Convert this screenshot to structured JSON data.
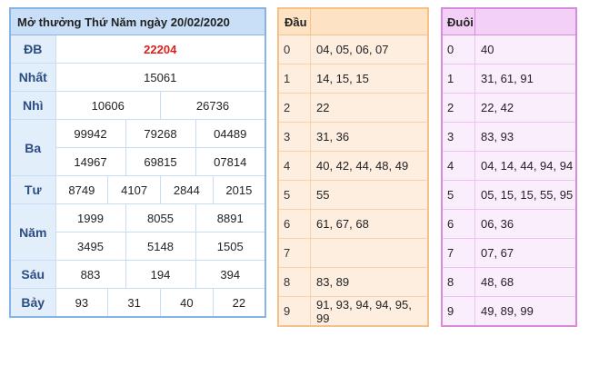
{
  "main": {
    "title": "Mở thưởng Thứ Năm ngày 20/02/2020",
    "rows": {
      "db": {
        "label": "ĐB",
        "values": [
          "22204"
        ]
      },
      "nhat": {
        "label": "Nhất",
        "values": [
          "15061"
        ]
      },
      "nhi": {
        "label": "Nhì",
        "values": [
          "10606",
          "26736"
        ]
      },
      "ba": {
        "label": "Ba",
        "values": [
          "99942",
          "79268",
          "04489",
          "14967",
          "69815",
          "07814"
        ]
      },
      "tu": {
        "label": "Tư",
        "values": [
          "8749",
          "4107",
          "2844",
          "2015"
        ]
      },
      "nam": {
        "label": "Năm",
        "values": [
          "1999",
          "8055",
          "8891",
          "3495",
          "5148",
          "1505"
        ]
      },
      "sau": {
        "label": "Sáu",
        "values": [
          "883",
          "194",
          "394"
        ]
      },
      "bay": {
        "label": "Bảy",
        "values": [
          "93",
          "31",
          "40",
          "22"
        ]
      }
    }
  },
  "dau": {
    "header": "Đầu",
    "rows": [
      {
        "k": "0",
        "v": "04, 05, 06, 07"
      },
      {
        "k": "1",
        "v": "14, 15, 15"
      },
      {
        "k": "2",
        "v": "22"
      },
      {
        "k": "3",
        "v": "31, 36"
      },
      {
        "k": "4",
        "v": "40, 42, 44, 48, 49"
      },
      {
        "k": "5",
        "v": "55"
      },
      {
        "k": "6",
        "v": "61, 67, 68"
      },
      {
        "k": "7",
        "v": ""
      },
      {
        "k": "8",
        "v": "83, 89"
      },
      {
        "k": "9",
        "v": "91, 93, 94, 94, 95, 99"
      }
    ]
  },
  "duoi": {
    "header": "Đuôi",
    "rows": [
      {
        "k": "0",
        "v": "40"
      },
      {
        "k": "1",
        "v": "31, 61, 91"
      },
      {
        "k": "2",
        "v": "22, 42"
      },
      {
        "k": "3",
        "v": "83, 93"
      },
      {
        "k": "4",
        "v": "04, 14, 44, 94, 94"
      },
      {
        "k": "5",
        "v": "05, 15, 15, 55, 95"
      },
      {
        "k": "6",
        "v": "06, 36"
      },
      {
        "k": "7",
        "v": "07, 67"
      },
      {
        "k": "8",
        "v": "48, 68"
      },
      {
        "k": "9",
        "v": "49, 89, 99"
      }
    ]
  }
}
